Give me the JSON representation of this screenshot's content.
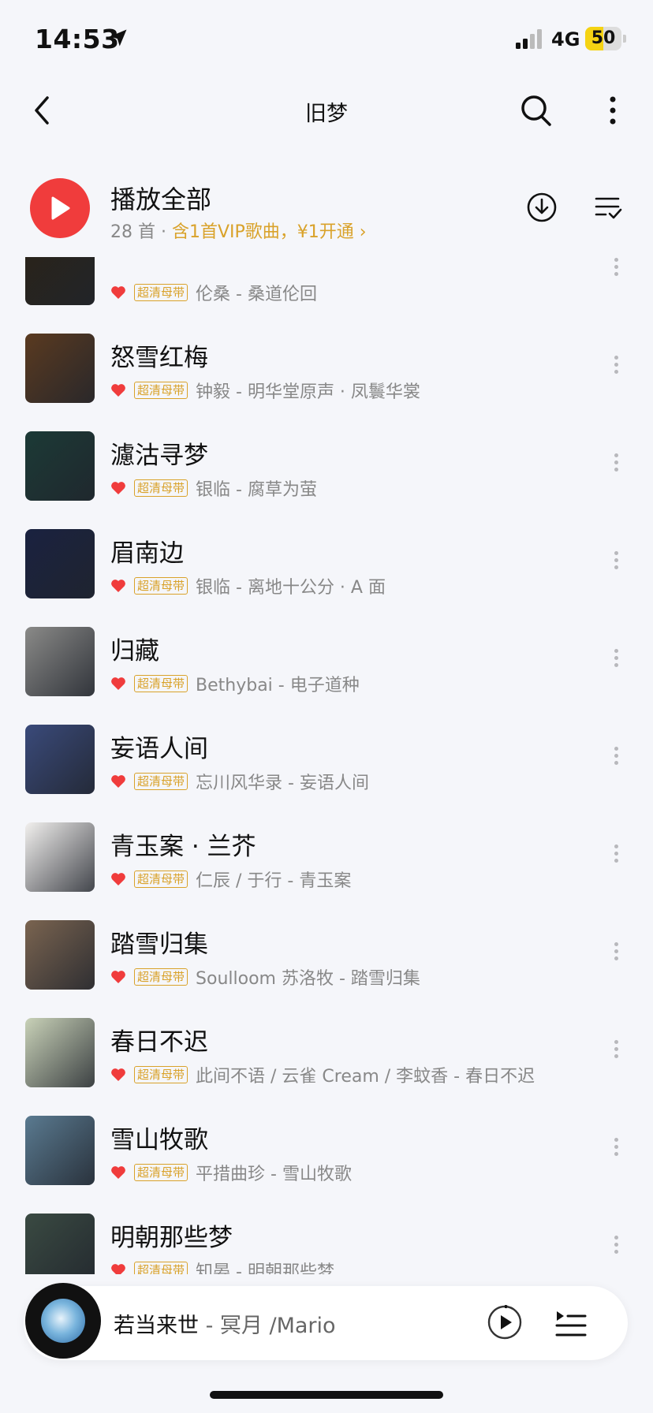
{
  "status_bar": {
    "time": "14:53",
    "network": "4G",
    "battery": "50",
    "battery_level": 0.5,
    "battery_color": "#f5d313"
  },
  "nav": {
    "title": "旧梦"
  },
  "play_all": {
    "title": "播放全部",
    "count": "28 首",
    "separator": " · ",
    "vip_text": "含1首VIP歌曲，¥1开通 ›",
    "accent": "#f03c3c",
    "vip_color": "#d9a22a"
  },
  "songs": [
    {
      "title": "",
      "tag": "超清母带",
      "artist": "伦桑 - 桑道伦回",
      "cover": "#2a2318"
    },
    {
      "title": "怒雪红梅",
      "tag": "超清母带",
      "artist": "钟毅 - 明华堂原声 · 凤鬟华裳",
      "cover": "#5a3a20"
    },
    {
      "title": "濾沽寻梦",
      "tag": "超清母带",
      "artist": "银临 - 腐草为萤",
      "cover": "#1c3a36"
    },
    {
      "title": "眉南边",
      "tag": "超清母带",
      "artist": "银临 - 离地十公分 · A 面",
      "cover": "#1a2240"
    },
    {
      "title": "归藏",
      "tag": "超清母带",
      "artist": "Bethybai - 电子道种",
      "cover": "#8a8a88"
    },
    {
      "title": "妄语人间",
      "tag": "超清母带",
      "artist": "忘川风华录 - 妄语人间",
      "cover": "#3a4a7a"
    },
    {
      "title": "青玉案 · 兰芥",
      "tag": "超清母带",
      "artist": "仁辰 / 于行 - 青玉案",
      "cover": "#f2f0ee"
    },
    {
      "title": "踏雪归集",
      "tag": "超清母带",
      "artist": "Soulloom 苏洛牧 - 踏雪归集",
      "cover": "#7a6450"
    },
    {
      "title": "春日不迟",
      "tag": "超清母带",
      "artist": "此间不语 / 云雀 Cream / 李蚊香 - 春日不迟",
      "cover": "#c9d2b8"
    },
    {
      "title": "雪山牧歌",
      "tag": "超清母带",
      "artist": "平措曲珍 - 雪山牧歌",
      "cover": "#5a7a90"
    },
    {
      "title": "明朝那些梦",
      "tag": "超清母带",
      "artist": "知晏 - 明朝那些梦",
      "cover": "#3a4a42"
    }
  ],
  "player": {
    "song": "若当来世",
    "artist": " - 冥月 /Mario"
  },
  "colors": {
    "heart": "#f03c3c",
    "tag": "#d9a22a",
    "background": "#f5f6fa"
  },
  "icons": [
    "chevron-left-icon",
    "search-icon",
    "more-vertical-icon",
    "play-icon",
    "download-icon",
    "multi-select-icon",
    "heart-icon",
    "play-circle-icon",
    "queue-icon",
    "location-arrow-icon",
    "signal-icon",
    "battery-icon"
  ]
}
